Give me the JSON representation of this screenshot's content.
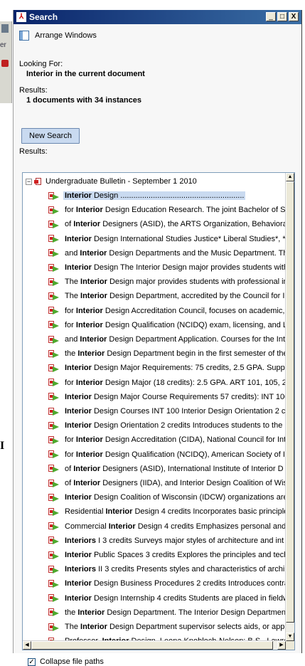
{
  "window": {
    "title": "Search",
    "min": "_",
    "max": "□",
    "close": "X"
  },
  "arrange_label": "Arrange Windows",
  "looking_for_label": "Looking For:",
  "looking_for_value": "Interior in the current document",
  "results_label": "Results:",
  "results_value": "1 documents with 34 instances",
  "new_search_label": "New Search",
  "results_list_label": "Results:",
  "tree": {
    "root_label": "Undergraduate Bulletin - September 1 2010",
    "expander": "−",
    "items": [
      {
        "pre": "",
        "hit": "Interior",
        "post": " Design .........................................................",
        "selected": true
      },
      {
        "pre": "for ",
        "hit": "Interior",
        "post": " Design Education Research. The joint Bachelor of Sc"
      },
      {
        "pre": "of ",
        "hit": "Interior",
        "post": " Designers (ASID), the ARTS Organization, Behavioral"
      },
      {
        "pre": "",
        "hit": "Interior",
        "post": " Design International Studies Justice* Liberal Studies*, *"
      },
      {
        "pre": "and ",
        "hit": "Interior",
        "post": " Design Departments and the Music Department. The"
      },
      {
        "pre": "",
        "hit": "Interior",
        "post": " Design The Interior Design major provides students with"
      },
      {
        "pre": "The ",
        "hit": "Interior",
        "post": " Design major provides students with professional in"
      },
      {
        "pre": "The ",
        "hit": "Interior",
        "post": " Design Department, accredited by the Council for Ir"
      },
      {
        "pre": "for ",
        "hit": "Interior",
        "post": " Design Accreditation Council, focuses on academic, p"
      },
      {
        "pre": "for ",
        "hit": "Interior",
        "post": " Design Qualification (NCIDQ) exam, licensing, and Le"
      },
      {
        "pre": "and ",
        "hit": "Interior",
        "post": " Design Department Application. Courses for the Int"
      },
      {
        "pre": "the ",
        "hit": "Interior",
        "post": " Design Department begin in the first semester of the"
      },
      {
        "pre": "",
        "hit": "Interior",
        "post": " Design Major Requirements: 75 credits, 2.5 GPA. Suppo"
      },
      {
        "pre": "for ",
        "hit": "Interior",
        "post": " Design Major (18 credits): 2.5 GPA. ART 101, 105, 2"
      },
      {
        "pre": "",
        "hit": "Interior",
        "post": " Design Major Course Requirements 57 credits): INT 100"
      },
      {
        "pre": "",
        "hit": "Interior",
        "post": " Design Courses INT 100 Interior Design Orientation 2 cr"
      },
      {
        "pre": "",
        "hit": "Interior",
        "post": " Design Orientation 2 credits Introduces students to the"
      },
      {
        "pre": "for ",
        "hit": "Interior",
        "post": " Design Accreditation (CIDA), National Council for Int"
      },
      {
        "pre": "for ",
        "hit": "Interior",
        "post": " Design Qualification (NCIDQ), American Society of Ir"
      },
      {
        "pre": "of ",
        "hit": "Interior",
        "post": " Designers (ASID), International Institute of Interior D"
      },
      {
        "pre": "of ",
        "hit": "Interior",
        "post": " Designers (IIDA), and Interior Design Coalition of Wis"
      },
      {
        "pre": "",
        "hit": "Interior",
        "post": " Design Coalition of Wisconsin (IDCW) organizations are"
      },
      {
        "pre": "Residential ",
        "hit": "Interior",
        "post": " Design 4 credits Incorporates basic principles"
      },
      {
        "pre": "Commercial ",
        "hit": "Interior",
        "post": " Design 4 credits Emphasizes personal and pu"
      },
      {
        "pre": "",
        "hit": "Interiors",
        "post": " I 3 credits Surveys major styles of architecture and int"
      },
      {
        "pre": "",
        "hit": "Interior",
        "post": " Public Spaces 3 credits Explores the principles and techr"
      },
      {
        "pre": "",
        "hit": "Interiors",
        "post": " II 3 credits Presents styles and characteristics of archil"
      },
      {
        "pre": "",
        "hit": "Interior",
        "post": " Design Business Procedures 2 credits Introduces contrac"
      },
      {
        "pre": "",
        "hit": "Interior",
        "post": " Design Internship 4 credits Students are placed in fieldw"
      },
      {
        "pre": "the ",
        "hit": "Interior",
        "post": " Design Department. The Interior Design Department"
      },
      {
        "pre": "The ",
        "hit": "Interior",
        "post": " Design Department supervisor selects aids, or appro"
      },
      {
        "pre": "Professor, ",
        "hit": "Interior",
        "post": " Design. Leona Knobloch-Nelson: B.S., Lawrer"
      }
    ]
  },
  "collapse_label": "Collapse file paths",
  "collapse_checked": "✓",
  "background": {
    "left_text": "er",
    "stray_letter": "I"
  },
  "icons": {
    "title": "search-app-icon",
    "arrange": "arrange-windows-icon",
    "pdf": "pdf-file-icon",
    "hit": "search-hit-icon"
  }
}
